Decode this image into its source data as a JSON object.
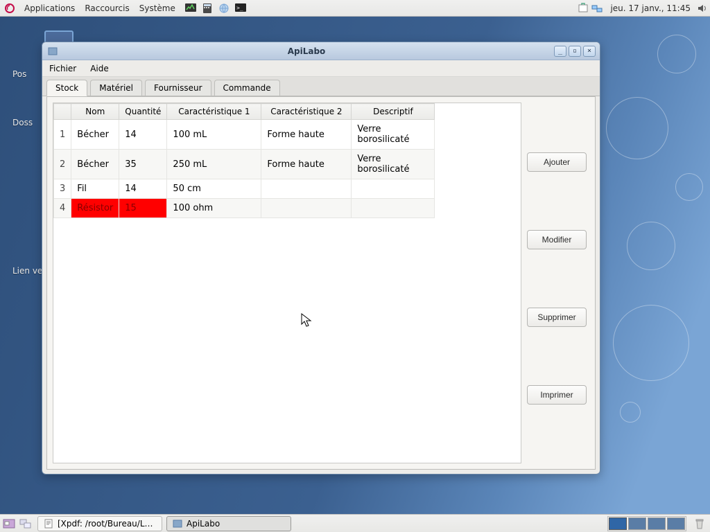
{
  "panel": {
    "apps": "Applications",
    "shortcuts": "Raccourcis",
    "system": "Système",
    "clock": "jeu. 17 janv., 11:45"
  },
  "desktop_labels": {
    "l1": "Pos",
    "l2": "Doss",
    "l3": "Lien ve"
  },
  "window": {
    "title": "ApiLabo",
    "menu": {
      "file": "Fichier",
      "help": "Aide"
    },
    "tabs": {
      "stock": "Stock",
      "materiel": "Matériel",
      "fournisseur": "Fournisseur",
      "commande": "Commande"
    },
    "columns": {
      "rownum": "",
      "nom": "Nom",
      "qte": "Quantité",
      "c1": "Caractéristique 1",
      "c2": "Caractéristique 2",
      "desc": "Descriptif"
    },
    "rows": [
      {
        "n": "1",
        "nom": "Bécher",
        "qte": "14",
        "c1": "100 mL",
        "c2": "Forme haute",
        "desc": "Verre borosilicaté",
        "hl": false
      },
      {
        "n": "2",
        "nom": "Bécher",
        "qte": "35",
        "c1": "250 mL",
        "c2": "Forme haute",
        "desc": "Verre borosilicaté",
        "hl": false
      },
      {
        "n": "3",
        "nom": "Fil",
        "qte": "14",
        "c1": "50 cm",
        "c2": "",
        "desc": "",
        "hl": false
      },
      {
        "n": "4",
        "nom": "Résistor",
        "qte": "15",
        "c1": "100 ohm",
        "c2": "",
        "desc": "",
        "hl": true
      }
    ],
    "buttons": {
      "add": "Ajouter",
      "edit": "Modifier",
      "delete": "Supprimer",
      "print": "Imprimer"
    }
  },
  "taskbar": {
    "task1": "[Xpdf: /root/Bureau/L…",
    "task2": "ApiLabo"
  }
}
